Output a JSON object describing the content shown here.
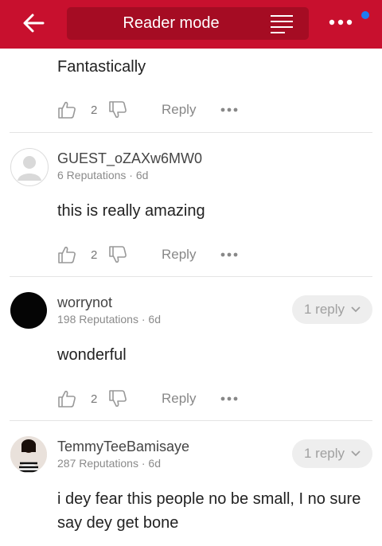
{
  "header": {
    "title": "Reader mode",
    "back_icon": "arrow-left-icon",
    "reader_icon": "text-lines-icon",
    "more_icon": "more-dots-icon",
    "accent_color": "#c8102e",
    "notification_dot_color": "#1e7cf2"
  },
  "comments": [
    {
      "body": "Fantastically",
      "likes": "2",
      "reply_label": "Reply"
    },
    {
      "author": "GUEST_oZAXw6MW0",
      "reputations": "6 Reputations",
      "age": "6d",
      "body": "this is really amazing",
      "likes": "2",
      "reply_label": "Reply"
    },
    {
      "author": "worrynot",
      "reputations": "198 Reputations",
      "age": "6d",
      "replies": "1 reply",
      "body": "wonderful",
      "likes": "2",
      "reply_label": "Reply"
    },
    {
      "author": "TemmyTeeBamisaye",
      "reputations": "287 Reputations",
      "age": "6d",
      "replies": "1 reply",
      "body": "i dey fear this people no be small, I no sure say dey get bone"
    }
  ],
  "separator": " · "
}
